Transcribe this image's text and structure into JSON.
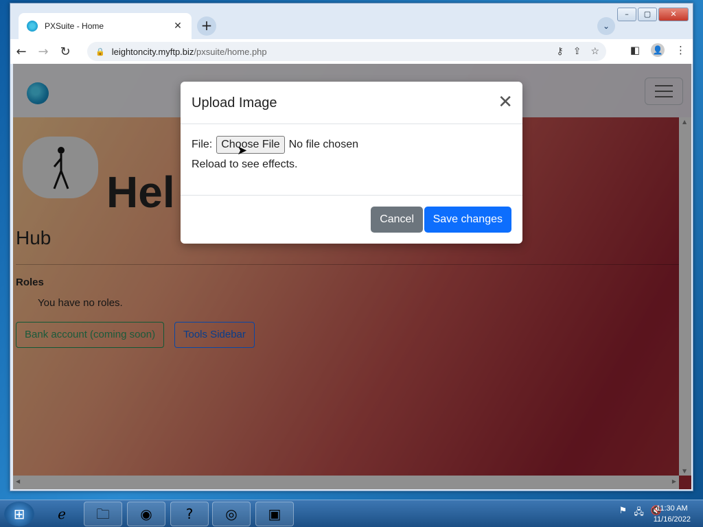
{
  "browser": {
    "tab_title": "PXSuite - Home",
    "url_host": "leightoncity.myftp.biz",
    "url_path": "/pxsuite/home.php",
    "new_tab_glyph": "+",
    "tab_close_glyph": "✕",
    "tab_search_glyph": "⌄"
  },
  "page": {
    "greeting": "Hel",
    "hub_title": "Hub",
    "roles_heading": "Roles",
    "roles_text": "You have no roles.",
    "bank_button": "Bank account (coming soon)",
    "tools_button": "Tools Sidebar"
  },
  "modal": {
    "title": "Upload Image",
    "file_label": "File:",
    "choose_file": "Choose File",
    "no_file": "No file chosen",
    "reload_note": "Reload to see effects.",
    "cancel": "Cancel",
    "save": "Save changes"
  },
  "taskbar": {
    "time": "11:30 AM",
    "date": "11/16/2022"
  },
  "colors": {
    "primary": "#0d6efd",
    "secondary": "#6c757d",
    "success_outline": "#198754"
  }
}
